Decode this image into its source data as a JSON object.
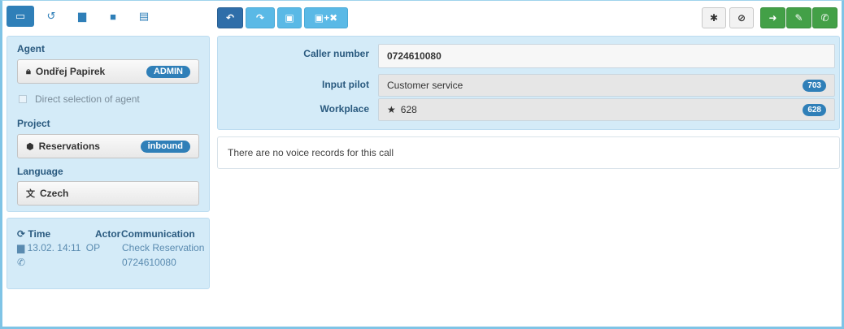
{
  "toolbar": {
    "tabs": [
      {
        "icon": "window-icon",
        "glyph": "▭"
      },
      {
        "icon": "history-icon",
        "glyph": "↺"
      },
      {
        "icon": "briefcase-icon",
        "glyph": "▆"
      },
      {
        "icon": "book-icon",
        "glyph": "■"
      },
      {
        "icon": "id-card-icon",
        "glyph": "▤"
      }
    ],
    "undo_glyph": "↶",
    "redo_glyph": "↷",
    "save_glyph": "▣",
    "save_close_glyph": "▣+✖",
    "settings_glyph": "✱",
    "check_glyph": "⊘",
    "login_glyph": "➜",
    "edit_glyph": "✎",
    "phone_glyph": "✆"
  },
  "agent_panel": {
    "agent_title": "Agent",
    "agent_name": "Ondřej Papirek",
    "agent_role": "ADMIN",
    "direct_selection_label": "Direct selection of agent",
    "project_title": "Project",
    "project_name": "Reservations",
    "project_type": "inbound",
    "language_title": "Language",
    "language_name": "Czech"
  },
  "history": {
    "col_time": "Time",
    "col_actor": "Actor",
    "col_communication": "Communication",
    "rows": [
      {
        "time": "13.02. 14:11",
        "actor": "OP",
        "communication": "Check Reservation",
        "detail": "0724610080"
      }
    ]
  },
  "call": {
    "caller_label": "Caller number",
    "caller_value": "0724610080",
    "pilot_label": "Input pilot",
    "pilot_value": "Customer service",
    "pilot_badge": "703",
    "workplace_label": "Workplace",
    "workplace_value": "628",
    "workplace_badge": "628"
  },
  "voice_notice": "There are no voice records for this call",
  "colors": {
    "primary": "#2f7fb8",
    "sky": "#5ab9e6",
    "green": "#43a047",
    "panel": "#d4ebf8"
  }
}
